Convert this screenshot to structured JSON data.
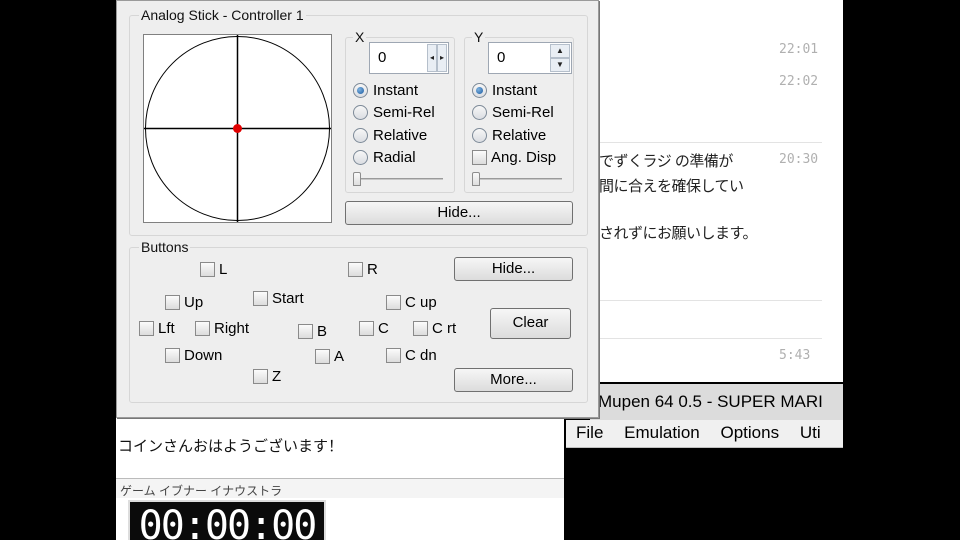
{
  "dialog": {
    "title": "Analog Stick - Controller 1",
    "x_axis": {
      "label": "X",
      "value": "0",
      "modes": [
        "Instant",
        "Semi-Rel",
        "Relative",
        "Radial"
      ],
      "selected": "Instant",
      "slider_value": 0
    },
    "y_axis": {
      "label": "Y",
      "value": "0",
      "modes": [
        "Instant",
        "Semi-Rel",
        "Relative"
      ],
      "selected": "Instant",
      "ang_disp_label": "Ang. Disp",
      "ang_disp_checked": false,
      "slider_value": 0
    },
    "stick_hide_label": "Hide...",
    "buttons_group": {
      "title": "Buttons",
      "hide_label": "Hide...",
      "clear_label": "Clear",
      "more_label": "More...",
      "items": {
        "l": "L",
        "r": "R",
        "up": "Up",
        "start": "Start",
        "c_up": "C up",
        "lft": "Lft",
        "right": "Right",
        "b": "B",
        "c": "C",
        "c_rt": "C rt",
        "down": "Down",
        "a": "A",
        "c_dn": "C dn",
        "z": "Z"
      }
    }
  },
  "colors": {
    "stick_marker": "#e00000",
    "radio_selected": "#1a5aa0"
  },
  "chat": {
    "times": [
      "22:01",
      "22:02",
      "20:30",
      "5:43"
    ],
    "lines": [
      "でずくラジ の準備が",
      "間に合えを確保してい",
      "されずにお願いします。"
    ]
  },
  "lower_window": {
    "message": "コインさんおはようございます！",
    "tabs": "ゲーム  イブナー  イナウストラ",
    "timer": "00:00:00"
  },
  "mupen": {
    "title": "Mupen 64  0.5 - SUPER MARI",
    "menu": [
      "File",
      "Emulation",
      "Options",
      "Uti"
    ]
  }
}
